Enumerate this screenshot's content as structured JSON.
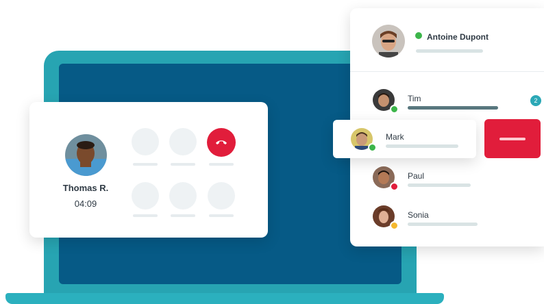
{
  "call": {
    "caller_name": "Thomas R.",
    "duration": "04:09",
    "hangup_icon": "phone-hangup-icon",
    "keypad_keys": 6
  },
  "contacts": {
    "current_user": {
      "name": "Antoine Dupont",
      "status": "online",
      "status_color": "#3cb54a"
    },
    "items": [
      {
        "name": "Tim",
        "status_color": "#3cb54a",
        "unread": "2"
      },
      {
        "name": "Mark",
        "status_color": "#3cb54a",
        "selected": true
      },
      {
        "name": "Paul",
        "status_color": "#e11d3b"
      },
      {
        "name": "Sonia",
        "status_color": "#f5b82e"
      }
    ],
    "remove_icon": "minus-icon"
  },
  "colors": {
    "laptop": "#27a4b2",
    "screen": "#065a86",
    "danger": "#e11d3b",
    "accent": "#2ba8b6"
  }
}
